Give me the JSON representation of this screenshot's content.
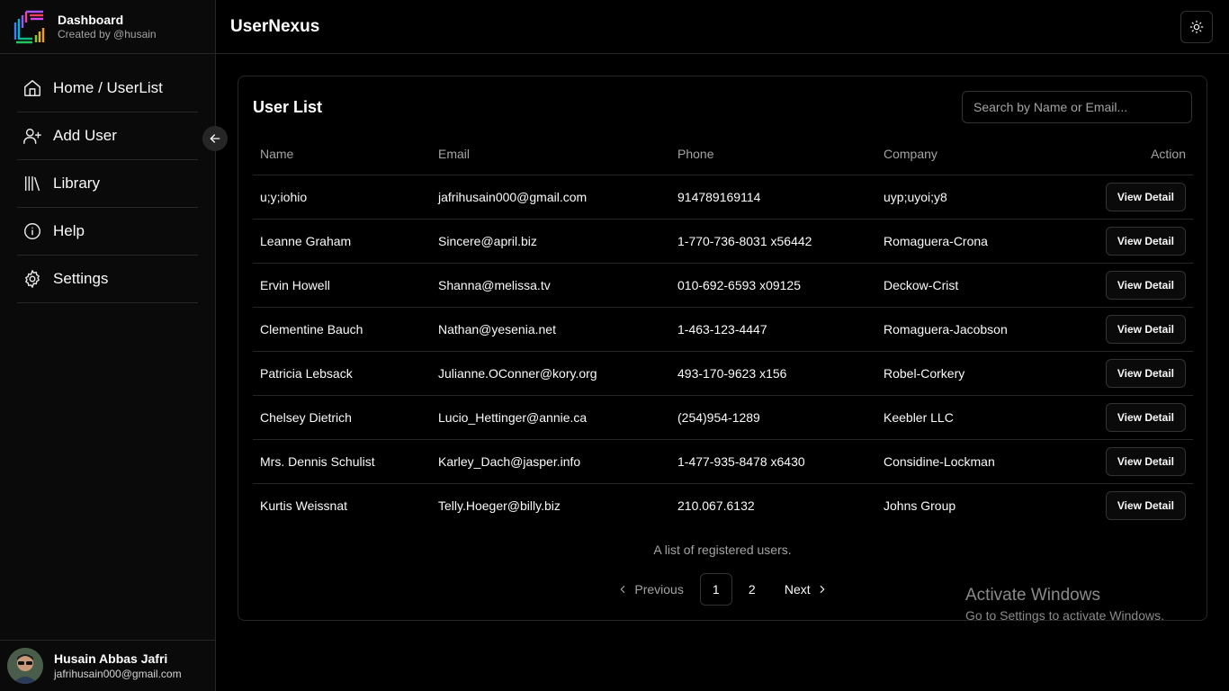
{
  "brand": {
    "title": "Dashboard",
    "subtitle": "Created by @husain"
  },
  "sidebar": {
    "items": [
      {
        "label": "Home / UserList",
        "icon": "home-icon"
      },
      {
        "label": "Add User",
        "icon": "user-plus-icon"
      },
      {
        "label": "Library",
        "icon": "library-icon"
      },
      {
        "label": "Help",
        "icon": "info-icon"
      },
      {
        "label": "Settings",
        "icon": "gear-icon"
      }
    ]
  },
  "user": {
    "name": "Husain Abbas Jafri",
    "email": "jafrihusain000@gmail.com"
  },
  "header": {
    "title": "UserNexus"
  },
  "userlist": {
    "title": "User List",
    "search_placeholder": "Search by Name or Email...",
    "columns": [
      "Name",
      "Email",
      "Phone",
      "Company",
      "Action"
    ],
    "rows": [
      {
        "name": "u;y;iohio",
        "email": "jafrihusain000@gmail.com",
        "phone": "914789169114",
        "company": "uyp;uyoi;y8"
      },
      {
        "name": "Leanne Graham",
        "email": "Sincere@april.biz",
        "phone": "1-770-736-8031 x56442",
        "company": "Romaguera-Crona"
      },
      {
        "name": "Ervin Howell",
        "email": "Shanna@melissa.tv",
        "phone": "010-692-6593 x09125",
        "company": "Deckow-Crist"
      },
      {
        "name": "Clementine Bauch",
        "email": "Nathan@yesenia.net",
        "phone": "1-463-123-4447",
        "company": "Romaguera-Jacobson"
      },
      {
        "name": "Patricia Lebsack",
        "email": "Julianne.OConner@kory.org",
        "phone": "493-170-9623 x156",
        "company": "Robel-Corkery"
      },
      {
        "name": "Chelsey Dietrich",
        "email": "Lucio_Hettinger@annie.ca",
        "phone": "(254)954-1289",
        "company": "Keebler LLC"
      },
      {
        "name": "Mrs. Dennis Schulist",
        "email": "Karley_Dach@jasper.info",
        "phone": "1-477-935-8478 x6430",
        "company": "Considine-Lockman"
      },
      {
        "name": "Kurtis Weissnat",
        "email": "Telly.Hoeger@billy.biz",
        "phone": "210.067.6132",
        "company": "Johns Group"
      }
    ],
    "action_label": "View Detail",
    "caption": "A list of registered users.",
    "pagination": {
      "previous": "Previous",
      "pages": [
        "1",
        "2"
      ],
      "current": "1",
      "next": "Next"
    }
  },
  "watermark": {
    "title": "Activate Windows",
    "subtitle": "Go to Settings to activate Windows."
  },
  "colors": {
    "background": "#000000",
    "sidebar": "#0a0a0a",
    "border": "#262626",
    "muted_text": "#a3a3a3"
  }
}
